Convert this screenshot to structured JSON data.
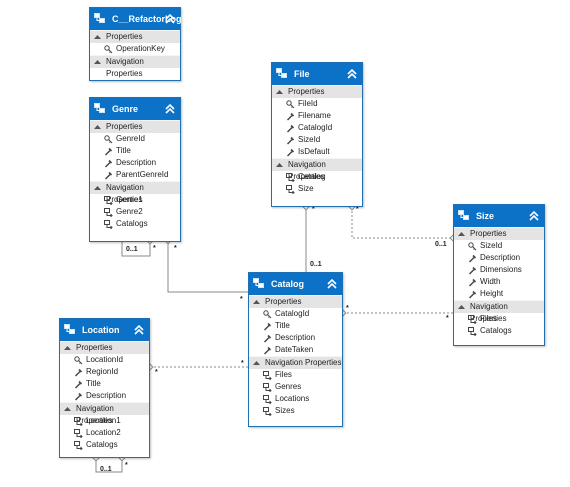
{
  "entities": {
    "refactorlog": {
      "title": "C__RefactorLog",
      "properties_label": "Properties",
      "properties": [
        "OperationKey"
      ],
      "navigation_label": "Navigation Properties",
      "navigation": []
    },
    "genre": {
      "title": "Genre",
      "properties_label": "Properties",
      "properties": [
        "GenreId",
        "Title",
        "Description",
        "ParentGenreId"
      ],
      "navigation_label": "Navigation Properties",
      "navigation": [
        "Genre1",
        "Genre2",
        "Catalogs"
      ]
    },
    "file": {
      "title": "File",
      "properties_label": "Properties",
      "properties": [
        "FileId",
        "Filename",
        "CatalogId",
        "SizeId",
        "IsDefault"
      ],
      "navigation_label": "Navigation Properties",
      "navigation": [
        "Catalog",
        "Size"
      ]
    },
    "size": {
      "title": "Size",
      "properties_label": "Properties",
      "properties": [
        "SizeId",
        "Description",
        "Dimensions",
        "Width",
        "Height"
      ],
      "navigation_label": "Navigation Properties",
      "navigation": [
        "Files",
        "Catalogs"
      ]
    },
    "catalog": {
      "title": "Catalog",
      "properties_label": "Properties",
      "properties": [
        "CatalogId",
        "Title",
        "Description",
        "DateTaken"
      ],
      "navigation_label": "Navigation Properties",
      "navigation": [
        "Files",
        "Genres",
        "Locations",
        "Sizes"
      ]
    },
    "location": {
      "title": "Location",
      "properties_label": "Properties",
      "properties": [
        "LocationId",
        "RegionId",
        "Title",
        "Description"
      ],
      "navigation_label": "Navigation Properties",
      "navigation": [
        "Location1",
        "Location2",
        "Catalogs"
      ]
    }
  },
  "multiplicities": {
    "genre_self_one": "0..1",
    "genre_self_many": "*",
    "genre_catalog_many": "*",
    "file_catalog_many": "*",
    "catalog_file_one": "0..1",
    "file_size_many": "*",
    "size_file_one": "0..1",
    "catalog_size_many": "*",
    "size_catalog_many": "*",
    "catalog_location_many": "*",
    "location_catalog_many": "*",
    "location_self_one": "0..1",
    "location_self_many": "*"
  },
  "colors": {
    "header": "#0b72c7",
    "border": "#1f6fb4",
    "section": "#e4e4e4",
    "connector": "#808080"
  }
}
